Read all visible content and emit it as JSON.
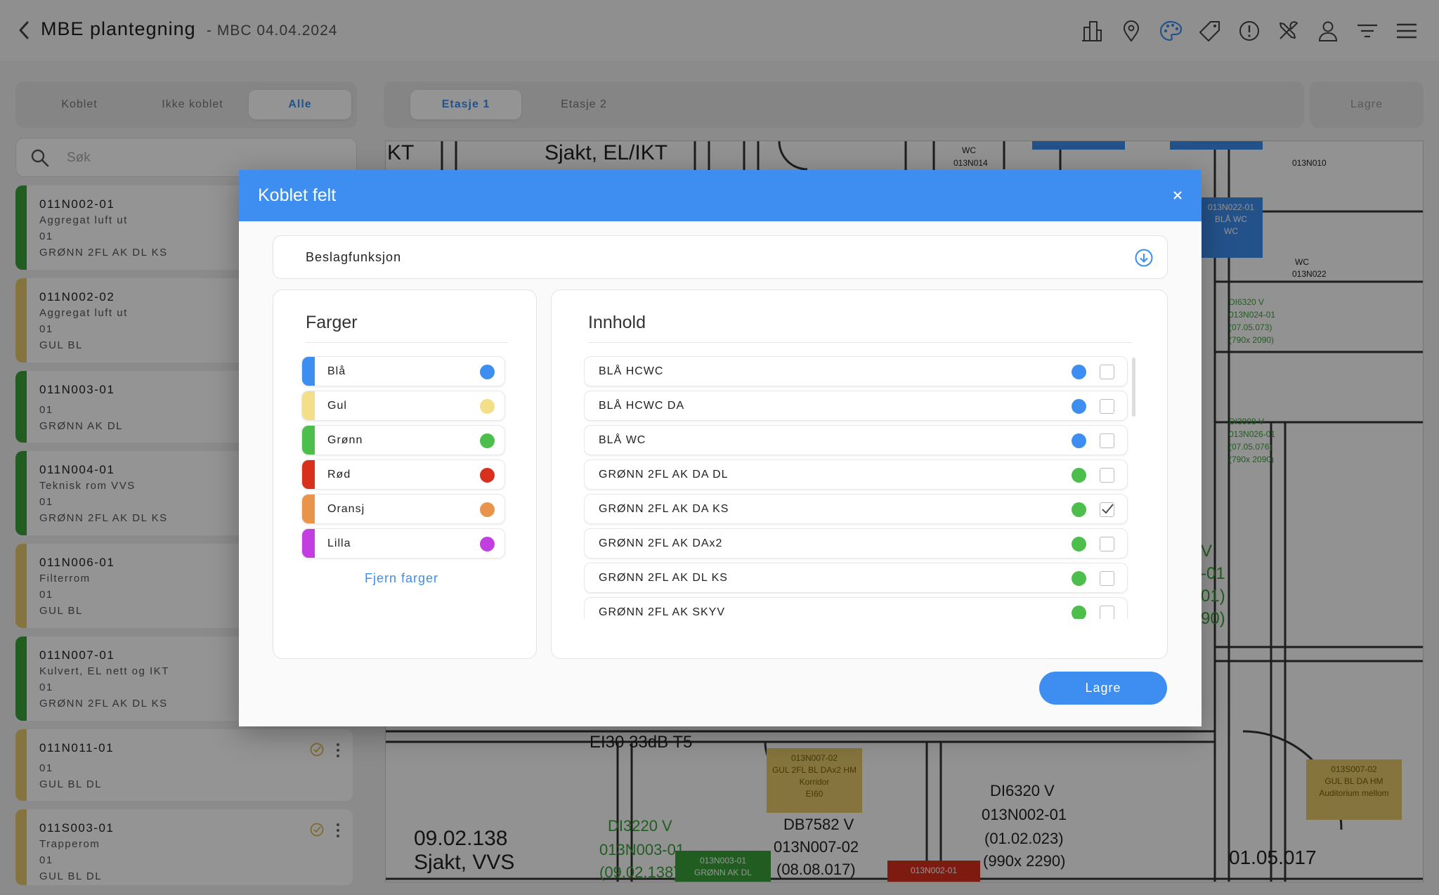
{
  "header": {
    "title": "MBE plantegning",
    "subtitle": "- MBC 04.04.2024",
    "icons": [
      "building-icon",
      "map-pin-icon",
      "palette-icon",
      "tag-icon",
      "info-icon",
      "tools-icon",
      "user-icon",
      "filter-icon",
      "menu-icon"
    ]
  },
  "filter_tabs": [
    {
      "label": "Koblet",
      "active": false
    },
    {
      "label": "Ikke koblet",
      "active": false
    },
    {
      "label": "Alle",
      "active": true
    }
  ],
  "floor_tabs": [
    {
      "label": "Etasje 1",
      "active": true
    },
    {
      "label": "Etasje 2",
      "active": false
    }
  ],
  "save_top_label": "Lagre",
  "search": {
    "placeholder": "Søk"
  },
  "colors_map": {
    "green": "#3aa13a",
    "yellow": "#e5c96a",
    "blue": "#3d8ef0",
    "red": "#d9301e"
  },
  "cards": [
    {
      "code": "011N002-01",
      "lines": [
        "Aggregat luft ut",
        "01",
        "GRØNN 2FL AK DL KS"
      ],
      "color": "#3aa13a"
    },
    {
      "code": "011N002-02",
      "lines": [
        "Aggregat luft ut",
        "01",
        "GUL BL"
      ],
      "color": "#e5c96a"
    },
    {
      "code": "011N003-01",
      "lines": [
        "01",
        "GRØNN AK DL"
      ],
      "color": "#3aa13a"
    },
    {
      "code": "011N004-01",
      "lines": [
        "Teknisk rom VVS",
        "01",
        "GRØNN 2FL AK DL KS"
      ],
      "color": "#3aa13a"
    },
    {
      "code": "011N006-01",
      "lines": [
        "Filterrom",
        "01",
        "GUL BL"
      ],
      "color": "#e5c96a"
    },
    {
      "code": "011N007-01",
      "lines": [
        "Kulvert, EL nett og IKT",
        "01",
        "GRØNN 2FL AK DL KS"
      ],
      "color": "#3aa13a"
    },
    {
      "code": "011N011-01",
      "lines": [
        "01",
        "GUL BL DL"
      ],
      "color": "#e5c96a"
    },
    {
      "code": "011S003-01",
      "lines": [
        "Trapperom",
        "01",
        "GUL BL DL"
      ],
      "color": "#e5c96a"
    }
  ],
  "floorplan": {
    "texts": [
      "KT",
      "Sjakt, EL/IKT",
      "WC",
      "013N014",
      "013N010",
      "WC",
      "013N022",
      "EI30 33dB T5",
      "09.02.138",
      "Sjakt, VVS",
      "DI3220 V",
      "013N003-01",
      "(09.02.138)",
      "DB7582 V",
      "013N007-02",
      "(08.08.017)",
      "DI6320 V",
      "013N002-01",
      "(01.02.023)",
      "(990x 2290)",
      "01.05.017",
      "DI6320 V",
      "013N024-01",
      "(07.05.073)",
      "(790x 2090)",
      "DI3008 V",
      "013N026-01",
      "(07.05.076)",
      "(790x 2090)",
      "V",
      "-01",
      "01)",
      "90)"
    ],
    "tags": [
      {
        "text": "013N022-01\nBLÅ WC\nWC",
        "color": "#3d8ef0"
      },
      {
        "text": "013N007-02\nGUL 2FL BL DAx2 HM\nKorridor\nEI60",
        "color": "#e5c96a"
      },
      {
        "text": "013S007-02\nGUL BL DA HM\nAuditorium mellom",
        "color": "#e5c96a"
      },
      {
        "text": "013N003-01\nGRØNN AK DL",
        "color": "#3aa13a"
      },
      {
        "text": "013N002-01",
        "color": "#d9301e"
      }
    ]
  },
  "modal": {
    "title": "Koblet felt",
    "dropdown_value": "Beslagfunksjon",
    "colors_title": "Farger",
    "colors": [
      {
        "name": "Blå",
        "color": "#3d8ef0"
      },
      {
        "name": "Gul",
        "color": "#f3de8a"
      },
      {
        "name": "Grønn",
        "color": "#4cbe4c"
      },
      {
        "name": "Rød",
        "color": "#d9301e"
      },
      {
        "name": "Oransj",
        "color": "#e8944a"
      },
      {
        "name": "Lilla",
        "color": "#c23ee0"
      }
    ],
    "remove_colors_label": "Fjern farger",
    "content_title": "Innhold",
    "content": [
      {
        "name": "BLÅ HCWC",
        "color": "#3d8ef0",
        "checked": false
      },
      {
        "name": "BLÅ HCWC DA",
        "color": "#3d8ef0",
        "checked": false
      },
      {
        "name": "BLÅ WC",
        "color": "#3d8ef0",
        "checked": false
      },
      {
        "name": "GRØNN 2FL AK DA DL",
        "color": "#4cbe4c",
        "checked": false
      },
      {
        "name": "GRØNN 2FL AK DA KS",
        "color": "#4cbe4c",
        "checked": true
      },
      {
        "name": "GRØNN 2FL AK DAx2",
        "color": "#4cbe4c",
        "checked": false
      },
      {
        "name": "GRØNN 2FL AK DL KS",
        "color": "#4cbe4c",
        "checked": false
      },
      {
        "name": "GRØNN 2FL AK SKYV",
        "color": "#4cbe4c",
        "checked": false
      }
    ],
    "save_label": "Lagre"
  }
}
